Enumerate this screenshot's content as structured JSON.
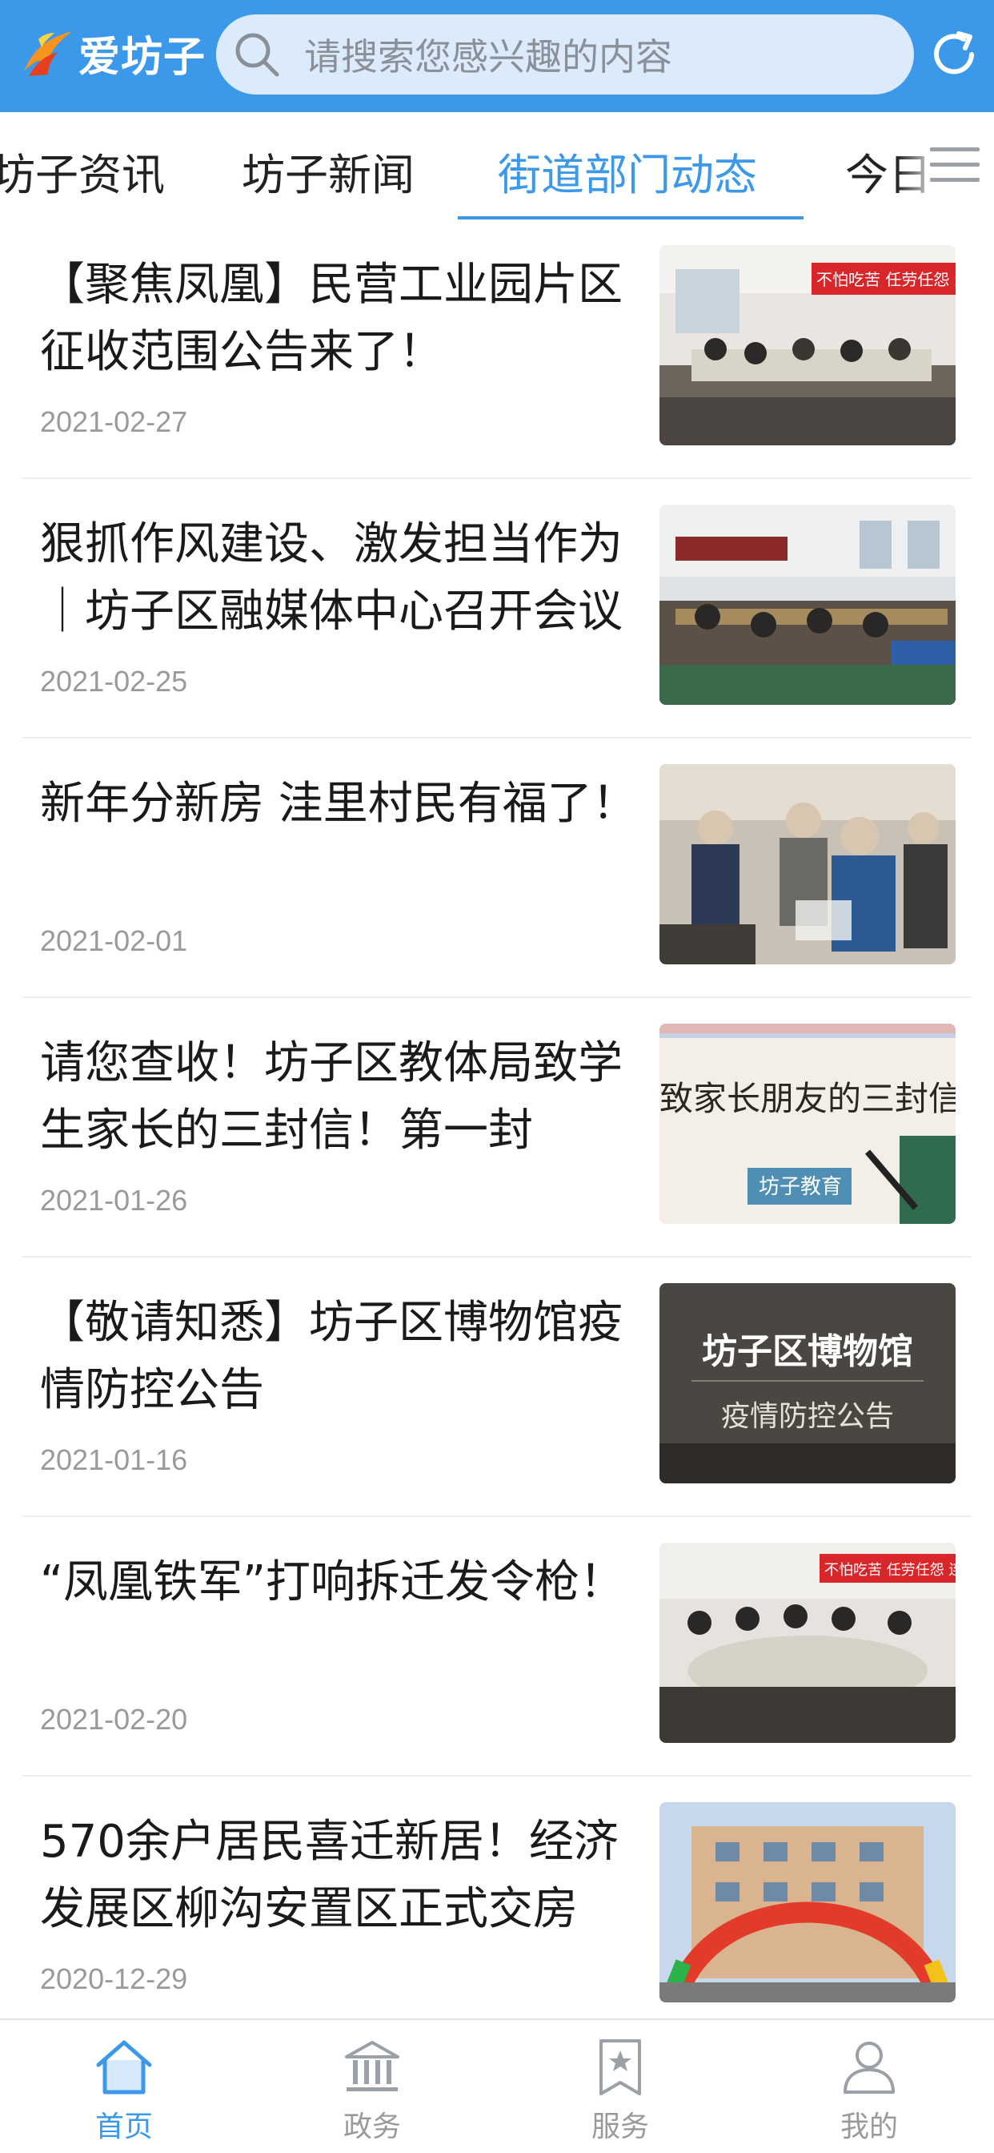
{
  "header": {
    "logo_text": "爱坊子",
    "search_placeholder": "请搜索您感兴趣的内容",
    "search_icon": "search-icon",
    "refresh_icon": "refresh-icon",
    "bg_color": "#3c99ea"
  },
  "tabs": {
    "items": [
      {
        "label": "坊子资讯"
      },
      {
        "label": "坊子新闻"
      },
      {
        "label": "街道部门动态"
      },
      {
        "label": "今日"
      }
    ],
    "active_index": 2,
    "menu_icon": "menu-icon",
    "accent": "#3c99ea"
  },
  "articles": [
    {
      "title": "【聚焦凤凰】民营工业园片区征收范围公告来了！",
      "date": "2021-02-27",
      "thumb_text": "不怕吃苦 任劳任怨 连续"
    },
    {
      "title": "狠抓作风建设、激发担当作为｜坊子区融媒体中心召开会议",
      "date": "2021-02-25"
    },
    {
      "title": "新年分新房  洼里村民有福了！",
      "date": "2021-02-01"
    },
    {
      "title": "请您查收！坊子区教体局致学生家长的三封信！第一封",
      "date": "2021-01-26",
      "thumb_text": "致家长朋友的三封信",
      "thumb_stamp": "坊子教育"
    },
    {
      "title": "【敬请知悉】坊子区博物馆疫情防控公告",
      "date": "2021-01-16",
      "thumb_text": "坊子区博物馆",
      "thumb_sub": "疫情防控公告"
    },
    {
      "title": "“凤凰铁军”打响拆迁发令枪！",
      "date": "2021-02-20",
      "thumb_text": "不怕吃苦 任劳任怨 连续作"
    },
    {
      "title": "570余户居民喜迁新居！经济发展区柳沟安置区正式交房",
      "date": "2020-12-29"
    }
  ],
  "bottom_nav": {
    "items": [
      {
        "label": "首页",
        "icon": "home-icon"
      },
      {
        "label": "政务",
        "icon": "government-icon"
      },
      {
        "label": "服务",
        "icon": "service-star-icon"
      },
      {
        "label": "我的",
        "icon": "user-icon"
      }
    ],
    "active_index": 0
  }
}
